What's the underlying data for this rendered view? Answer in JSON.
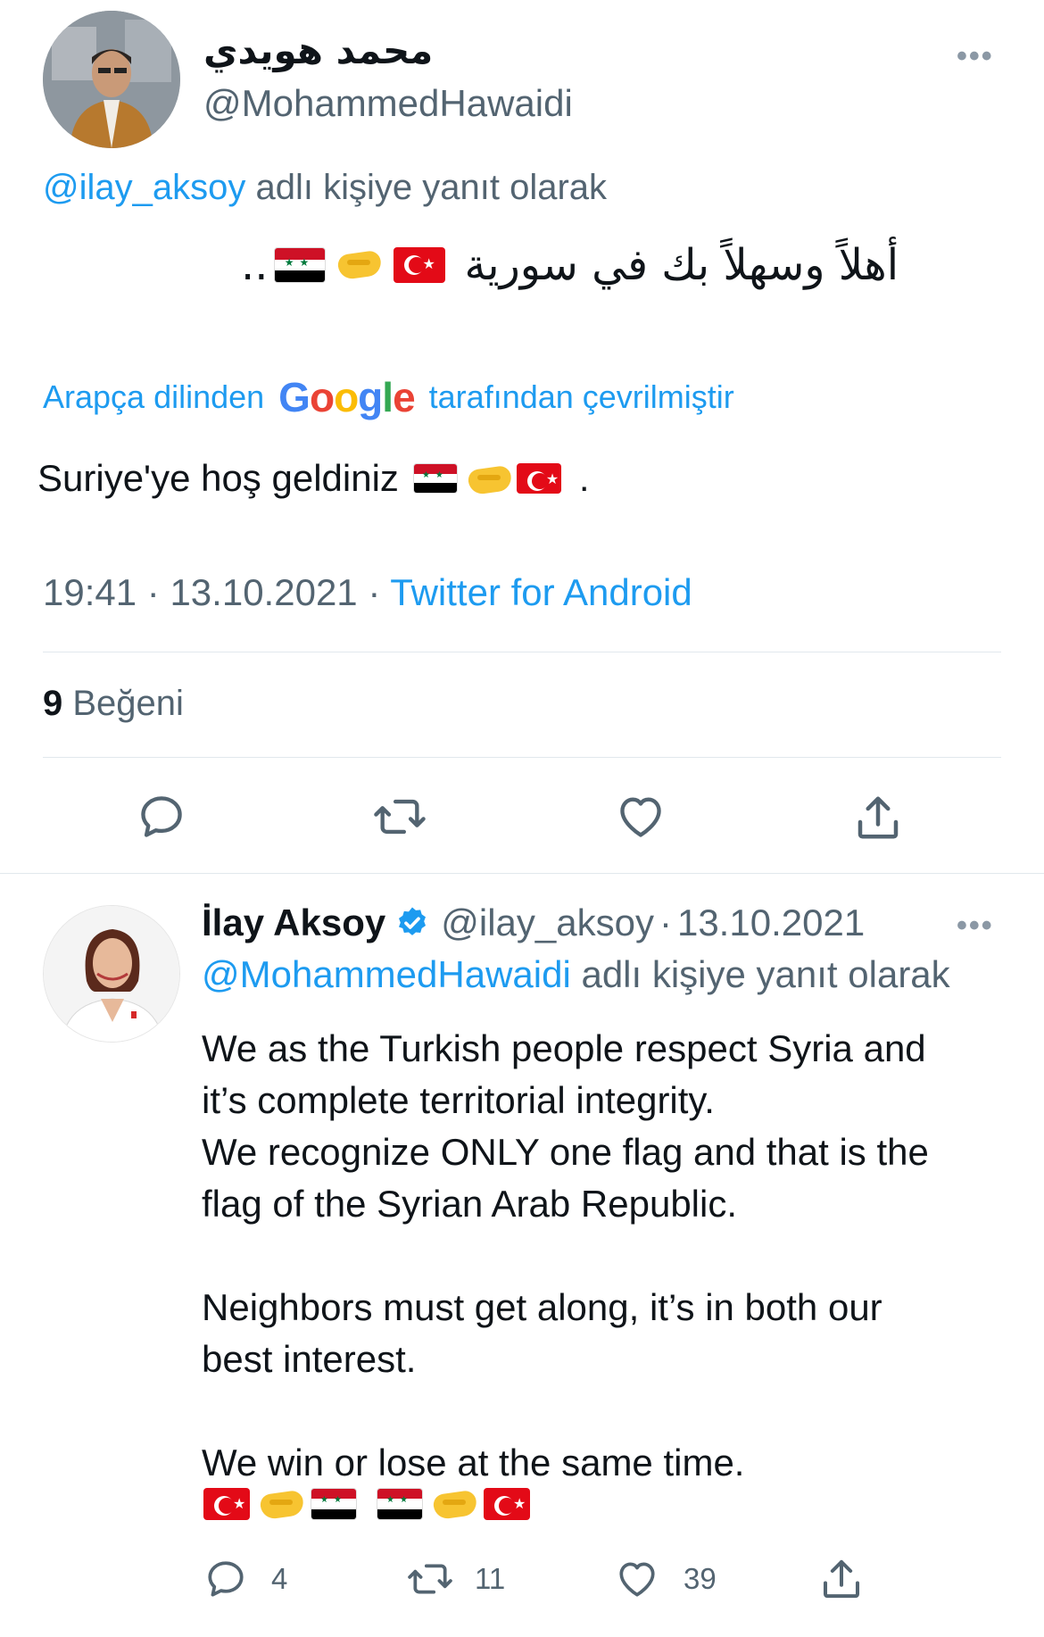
{
  "tweet": {
    "author_name": "محمد هويدي",
    "author_handle": "@MohammedHawaidi",
    "reply_to_handle": "@ilay_aksoy",
    "reply_to_suffix": "adlı kişiye yanıt olarak",
    "text_arabic": "أهلاً وسهلاً بك في سورية",
    "text_arabic_trail": "..",
    "translation_prefix": "Arapça dilinden",
    "translation_google": "Google",
    "translation_suffix": "tarafından çevrilmiştir",
    "translated_text": "Suriye'ye hoş geldiniz",
    "translated_trail": ".",
    "time": "19:41",
    "separator": "·",
    "date": "13.10.2021",
    "source": "Twitter for Android",
    "likes_count": "9",
    "likes_label": "Beğeni",
    "more_label": "•••"
  },
  "reply": {
    "author_name": "İlay Aksoy",
    "author_handle": "@ilay_aksoy",
    "separator": "·",
    "date": "13.10.2021",
    "reply_to_handle": "@MohammedHawaidi",
    "reply_to_suffix": "adlı kişiye yanıt olarak",
    "lines": [
      "We as the Turkish people respect Syria and",
      "it’s complete territorial integrity.",
      "We recognize ONLY one flag and that is the",
      "flag of the Syrian Arab Republic.",
      "Neighbors must get along, it’s in both our",
      "best interest.",
      "We win or lose at the same time."
    ],
    "reply_count": "4",
    "retweet_count": "11",
    "like_count": "39",
    "more_label": "•••"
  },
  "icons": {
    "verified": "verified-badge-icon",
    "reply": "reply-icon",
    "retweet": "retweet-icon",
    "like": "heart-icon",
    "share": "share-icon"
  },
  "colors": {
    "accent": "#1d9bf0",
    "text": "#0f1419",
    "muted": "#536471",
    "divider": "#e1e8ed"
  }
}
